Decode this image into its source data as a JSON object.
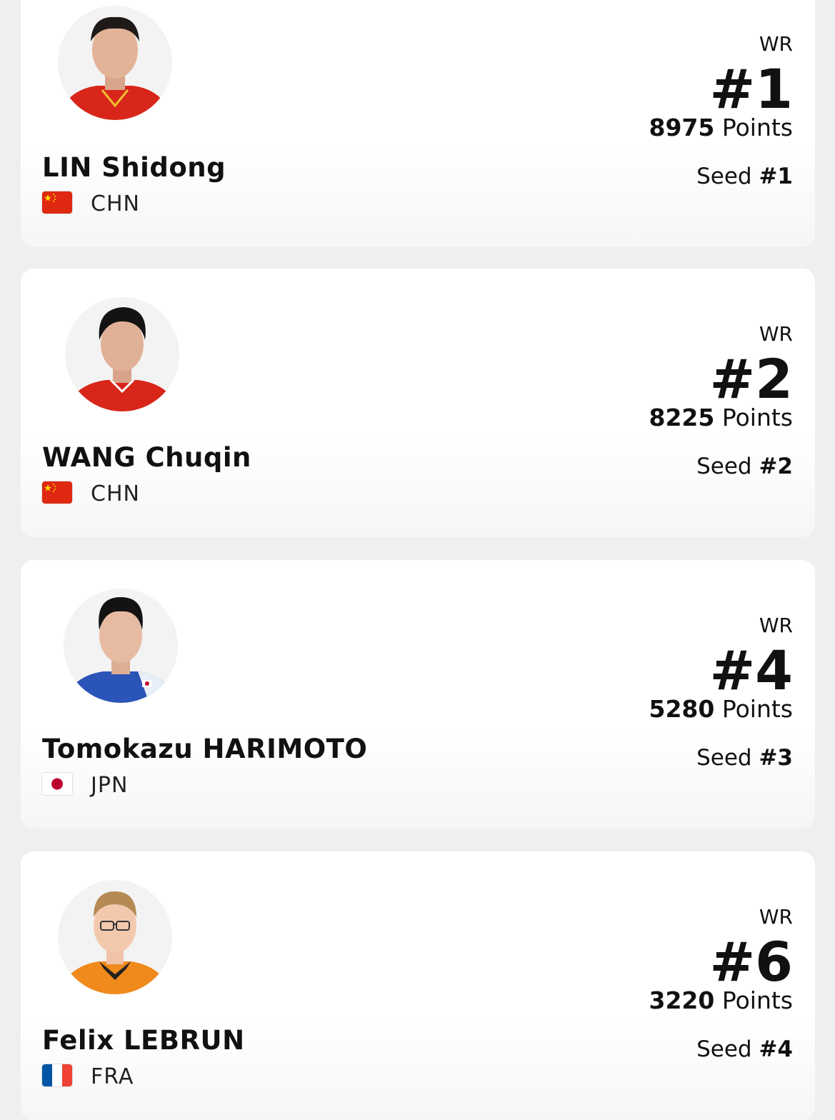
{
  "players": [
    {
      "name": "LIN Shidong",
      "country": "CHN",
      "flag": "china-flag",
      "wr_label": "WR",
      "wr": "#1",
      "points": "8975",
      "points_unit": "Points",
      "seed_label": "Seed",
      "seed": "#1"
    },
    {
      "name": "WANG Chuqin",
      "country": "CHN",
      "flag": "china-flag",
      "wr_label": "WR",
      "wr": "#2",
      "points": "8225",
      "points_unit": "Points",
      "seed_label": "Seed",
      "seed": "#2"
    },
    {
      "name": "Tomokazu HARIMOTO",
      "country": "JPN",
      "flag": "japan-flag",
      "wr_label": "WR",
      "wr": "#4",
      "points": "5280",
      "points_unit": "Points",
      "seed_label": "Seed",
      "seed": "#3"
    },
    {
      "name": "Felix LEBRUN",
      "country": "FRA",
      "flag": "france-flag",
      "wr_label": "WR",
      "wr": "#6",
      "points": "3220",
      "points_unit": "Points",
      "seed_label": "Seed",
      "seed": "#4"
    }
  ],
  "colors": {
    "china_red": "#de2910",
    "china_star": "#ffde00",
    "japan_red": "#bc002d",
    "france_blue": "#0055a4",
    "france_red": "#ef4135"
  }
}
